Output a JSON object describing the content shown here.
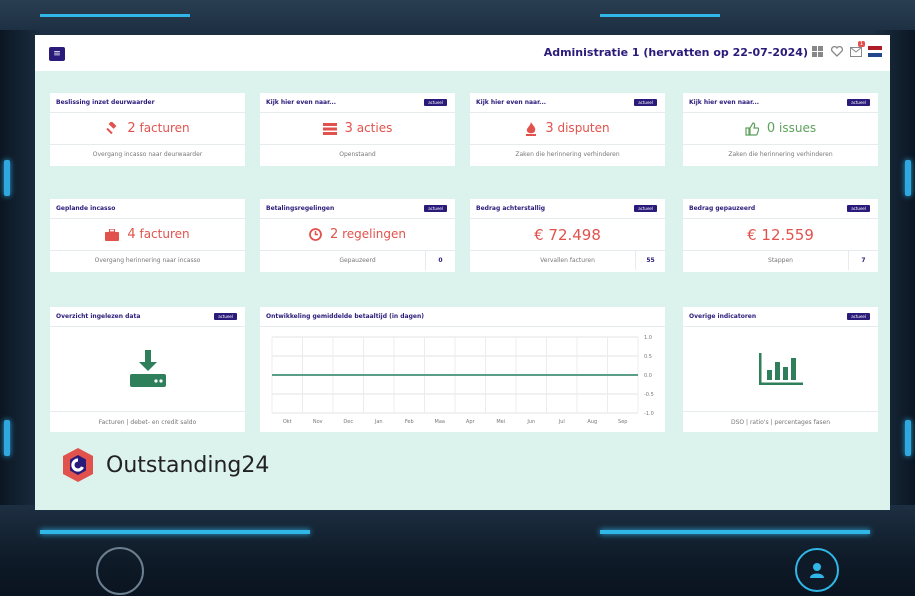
{
  "header": {
    "admin_title": "Administratie 1 (hervatten op 22-07-2024)",
    "menu_icon": "hamburger-icon",
    "icons": [
      "grid-icon",
      "heart-icon",
      "mail-icon",
      "flag-nl-icon"
    ],
    "mail_badge": "1"
  },
  "badge_label": "actueel",
  "row1": [
    {
      "title": "Beslissing inzet deurwaarder",
      "icon": "gavel-icon",
      "value": "2",
      "unit": "facturen",
      "footer": "Overgang incasso naar deurwaarder",
      "badge": false
    },
    {
      "title": "Kijk hier even naar...",
      "icon": "list-icon",
      "value": "3",
      "unit": "acties",
      "footer": "Openstaand",
      "badge": true
    },
    {
      "title": "Kijk hier even naar...",
      "icon": "fire-icon",
      "value": "3",
      "unit": "disputen",
      "footer": "Zaken die herinnering verhinderen",
      "badge": true
    },
    {
      "title": "Kijk hier even naar...",
      "icon": "thumbs-up-icon",
      "value": "0",
      "unit": "issues",
      "footer": "Zaken die herinnering verhinderen",
      "badge": true
    }
  ],
  "row2": [
    {
      "title": "Geplande incasso",
      "icon": "briefcase-icon",
      "value": "4",
      "unit": "facturen",
      "footer": "Overgang herinnering naar incasso",
      "count": "",
      "badge": false
    },
    {
      "title": "Betalingsregelingen",
      "icon": "clock-icon",
      "value": "2",
      "unit": "regelingen",
      "footer": "Gepauzeerd",
      "count": "0",
      "badge": true
    },
    {
      "title": "Bedrag achterstallig",
      "amount": "€ 72.498",
      "footer": "Vervallen facturen",
      "count": "55",
      "badge": true
    },
    {
      "title": "Bedrag gepauzeerd",
      "amount": "€ 12.559",
      "footer": "Stappen",
      "count": "7",
      "badge": true
    }
  ],
  "row3": {
    "data_card": {
      "title": "Overzicht ingelezen data",
      "footer": "Facturen | debet- en credit saldo",
      "icon": "download-server-icon"
    },
    "chart_card": {
      "title": "Ontwikkeling gemiddelde betaaltijd (in dagen)"
    },
    "indicators_card": {
      "title": "Overige indicatoren",
      "footer": "DSO | ratio's | percentages fasen",
      "icon": "bar-chart-icon"
    }
  },
  "chart_data": {
    "type": "line",
    "title": "Ontwikkeling gemiddelde betaaltijd (in dagen)",
    "categories": [
      "Okt",
      "Nov",
      "Dec",
      "Jan",
      "Feb",
      "Maa",
      "Apr",
      "Mei",
      "Jun",
      "Jul",
      "Aug",
      "Sep"
    ],
    "series": [
      {
        "values": [
          0,
          0,
          0,
          0,
          0,
          0,
          0,
          0,
          0,
          0,
          0,
          0
        ]
      }
    ],
    "ylim": [
      -1.0,
      1.0
    ],
    "yticks": [
      "1.0",
      "0.5",
      "0.0",
      "-0.5",
      "-1.0"
    ],
    "grid": true,
    "line_color": "#5a9e8a"
  },
  "brand": {
    "name": "Outstanding24"
  },
  "colors": {
    "brand": "#2a1a7a",
    "accent": "#e2524d",
    "positive": "#5ca15c",
    "teal": "#2f7f5a",
    "background": "#dcf2ec"
  }
}
